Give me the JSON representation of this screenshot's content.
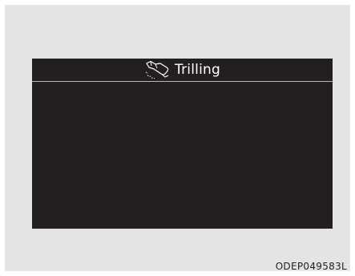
{
  "screen": {
    "icon": "tilted-steering-wheel-icon",
    "title": "Trilling"
  },
  "image_code": "ODEP049583L",
  "colors": {
    "background": "#e4e4e4",
    "screen": "#231f20",
    "text": "#ffffff",
    "divider": "#b9b6b0"
  }
}
